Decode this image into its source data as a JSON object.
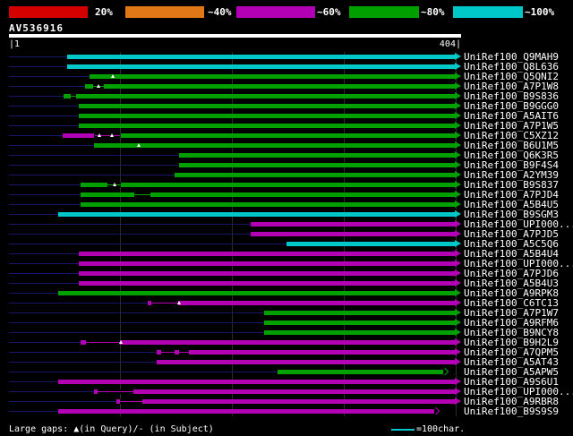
{
  "chart_data": {
    "type": "bar",
    "orientation": "horizontal-range",
    "description": "BLAST-style graphical overview: each row is a database hit; the colored bar spans the aligned region of the query (1-404), colored by score class per the color key.",
    "colors": {
      "red": "#d40000",
      "orange": "#e07818",
      "magenta": "#b400b4",
      "green": "#00a000",
      "cyan": "#00c8c8",
      "baseline_navy": "#16166a",
      "grid": "#2b2b2b",
      "white": "#ffffff",
      "background": "#000000"
    },
    "color_key": [
      {
        "label": "20%",
        "color": "red"
      },
      {
        "label": "~40%",
        "color": "orange"
      },
      {
        "label": "~60%",
        "color": "magenta"
      },
      {
        "label": "~80%",
        "color": "green"
      },
      {
        "label": "~100%",
        "color": "cyan"
      }
    ],
    "query": {
      "name": "AV536916",
      "length": 404,
      "start_label": "|1",
      "end_label": "404|"
    },
    "xlim": [
      1,
      404
    ],
    "gridline_interval": 100,
    "footer": {
      "gaps_note": "Large gaps: ▲(in Query)/- (in Subject)",
      "scale_label": "=100char."
    },
    "hits": [
      {
        "label": "UniRef100_Q9MAH9",
        "bars": [
          {
            "start": 53,
            "end": 404,
            "color": "cyan"
          }
        ]
      },
      {
        "label": "UniRef100_Q8L636",
        "bars": [
          {
            "start": 53,
            "end": 404,
            "color": "cyan"
          }
        ]
      },
      {
        "label": "UniRef100_Q5QNI2",
        "bars": [
          {
            "start": 73,
            "end": 404,
            "color": "green"
          }
        ],
        "markers": [
          94
        ]
      },
      {
        "label": "UniRef100_A7P1W8",
        "bars": [
          {
            "start": 69,
            "end": 404,
            "color": "green"
          }
        ],
        "thin": [
          {
            "start": 76,
            "end": 86,
            "color": "green"
          }
        ],
        "markers": [
          81
        ]
      },
      {
        "label": "UniRef100_B9S836",
        "bars": [
          {
            "start": 50,
            "end": 404,
            "color": "green"
          }
        ],
        "thin": [
          {
            "start": 56,
            "end": 61,
            "color": "green"
          }
        ]
      },
      {
        "label": "UniRef100_B9GGG0",
        "bars": [
          {
            "start": 63,
            "end": 404,
            "color": "green"
          }
        ]
      },
      {
        "label": "UniRef100_A5AIT6",
        "bars": [
          {
            "start": 63,
            "end": 404,
            "color": "green"
          }
        ]
      },
      {
        "label": "UniRef100_A7P1W5",
        "bars": [
          {
            "start": 63,
            "end": 404,
            "color": "green"
          }
        ]
      },
      {
        "label": "UniRef100_C5XZ12",
        "bars": [
          {
            "start": 49,
            "end": 77,
            "color": "magenta"
          },
          {
            "start": 101,
            "end": 404,
            "color": "green"
          }
        ],
        "thin": [
          {
            "start": 78,
            "end": 100,
            "color": "magenta"
          }
        ],
        "markers": [
          82,
          93
        ]
      },
      {
        "label": "UniRef100_B6U1M5",
        "bars": [
          {
            "start": 77,
            "end": 404,
            "color": "green"
          }
        ],
        "markers": [
          117
        ]
      },
      {
        "label": "UniRef100_Q6K3R5",
        "bars": [
          {
            "start": 153,
            "end": 404,
            "color": "green"
          }
        ]
      },
      {
        "label": "UniRef100_B9F4S4",
        "bars": [
          {
            "start": 153,
            "end": 404,
            "color": "green"
          }
        ]
      },
      {
        "label": "UniRef100_A2YM39",
        "bars": [
          {
            "start": 149,
            "end": 404,
            "color": "green"
          }
        ]
      },
      {
        "label": "UniRef100_B9S837",
        "bars": [
          {
            "start": 65,
            "end": 404,
            "color": "green"
          }
        ],
        "thin": [
          {
            "start": 89,
            "end": 101,
            "color": "green"
          }
        ],
        "markers": [
          95
        ]
      },
      {
        "label": "UniRef100_A7PJD4",
        "bars": [
          {
            "start": 65,
            "end": 404,
            "color": "green"
          }
        ],
        "thin": [
          {
            "start": 113,
            "end": 127,
            "color": "green"
          }
        ]
      },
      {
        "label": "UniRef100_A5B4U5",
        "bars": [
          {
            "start": 65,
            "end": 404,
            "color": "green"
          }
        ]
      },
      {
        "label": "UniRef100_B9SGM3",
        "bars": [
          {
            "start": 45,
            "end": 404,
            "color": "cyan"
          }
        ]
      },
      {
        "label": "UniRef100_UPI000...",
        "bars": [
          {
            "start": 217,
            "end": 404,
            "color": "magenta"
          }
        ]
      },
      {
        "label": "UniRef100_A7PJD5",
        "bars": [
          {
            "start": 217,
            "end": 404,
            "color": "magenta"
          }
        ]
      },
      {
        "label": "UniRef100_A5C5Q6",
        "bars": [
          {
            "start": 249,
            "end": 404,
            "color": "cyan"
          }
        ]
      },
      {
        "label": "UniRef100_A5B4U4",
        "bars": [
          {
            "start": 63,
            "end": 404,
            "color": "magenta"
          }
        ]
      },
      {
        "label": "UniRef100_UPI000...",
        "bars": [
          {
            "start": 63,
            "end": 404,
            "color": "magenta"
          }
        ]
      },
      {
        "label": "UniRef100_A7PJD6",
        "bars": [
          {
            "start": 63,
            "end": 404,
            "color": "magenta"
          }
        ]
      },
      {
        "label": "UniRef100_A5B4U3",
        "bars": [
          {
            "start": 63,
            "end": 404,
            "color": "magenta"
          }
        ]
      },
      {
        "label": "UniRef100_A9RPK8",
        "bars": [
          {
            "start": 45,
            "end": 404,
            "color": "green"
          }
        ]
      },
      {
        "label": "UniRef100_C6TC13",
        "bars": [
          {
            "start": 125,
            "end": 404,
            "color": "magenta"
          }
        ],
        "thin": [
          {
            "start": 128,
            "end": 152,
            "color": "magenta"
          }
        ],
        "markers": [
          153
        ]
      },
      {
        "label": "UniRef100_A7P1W7",
        "bars": [
          {
            "start": 229,
            "end": 404,
            "color": "green"
          }
        ]
      },
      {
        "label": "UniRef100_A9RFM6",
        "bars": [
          {
            "start": 229,
            "end": 404,
            "color": "green"
          }
        ]
      },
      {
        "label": "UniRef100_B9NCY8",
        "bars": [
          {
            "start": 229,
            "end": 404,
            "color": "green"
          }
        ]
      },
      {
        "label": "UniRef100_B9H2L9",
        "bars": [
          {
            "start": 65,
            "end": 404,
            "color": "magenta"
          }
        ],
        "thin": [
          {
            "start": 70,
            "end": 100,
            "color": "magenta"
          }
        ],
        "markers": [
          101
        ]
      },
      {
        "label": "UniRef100_A7QPM5",
        "bars": [
          {
            "start": 133,
            "end": 404,
            "color": "magenta"
          }
        ],
        "thin": [
          {
            "start": 137,
            "end": 149,
            "color": "magenta"
          },
          {
            "start": 153,
            "end": 162,
            "color": "magenta"
          }
        ]
      },
      {
        "label": "UniRef100_A5AT43",
        "bars": [
          {
            "start": 133,
            "end": 404,
            "color": "magenta"
          }
        ]
      },
      {
        "label": "UniRef100_A5APW5",
        "bars": [
          {
            "start": 241,
            "end": 393,
            "color": "green"
          }
        ],
        "arrow": {
          "style": "open"
        }
      },
      {
        "label": "UniRef100_A9S6U1",
        "bars": [
          {
            "start": 45,
            "end": 404,
            "color": "magenta"
          }
        ]
      },
      {
        "label": "UniRef100_UPI000...",
        "bars": [
          {
            "start": 77,
            "end": 404,
            "color": "magenta"
          }
        ],
        "thin": [
          {
            "start": 80,
            "end": 112,
            "color": "magenta"
          }
        ]
      },
      {
        "label": "UniRef100_A9RBR8",
        "bars": [
          {
            "start": 97,
            "end": 404,
            "color": "magenta"
          }
        ],
        "thin": [
          {
            "start": 100,
            "end": 120,
            "color": "magenta"
          }
        ]
      },
      {
        "label": "UniRef100_B9S9S9",
        "bars": [
          {
            "start": 45,
            "end": 385,
            "color": "magenta"
          }
        ],
        "arrow": {
          "style": "open"
        }
      }
    ]
  }
}
